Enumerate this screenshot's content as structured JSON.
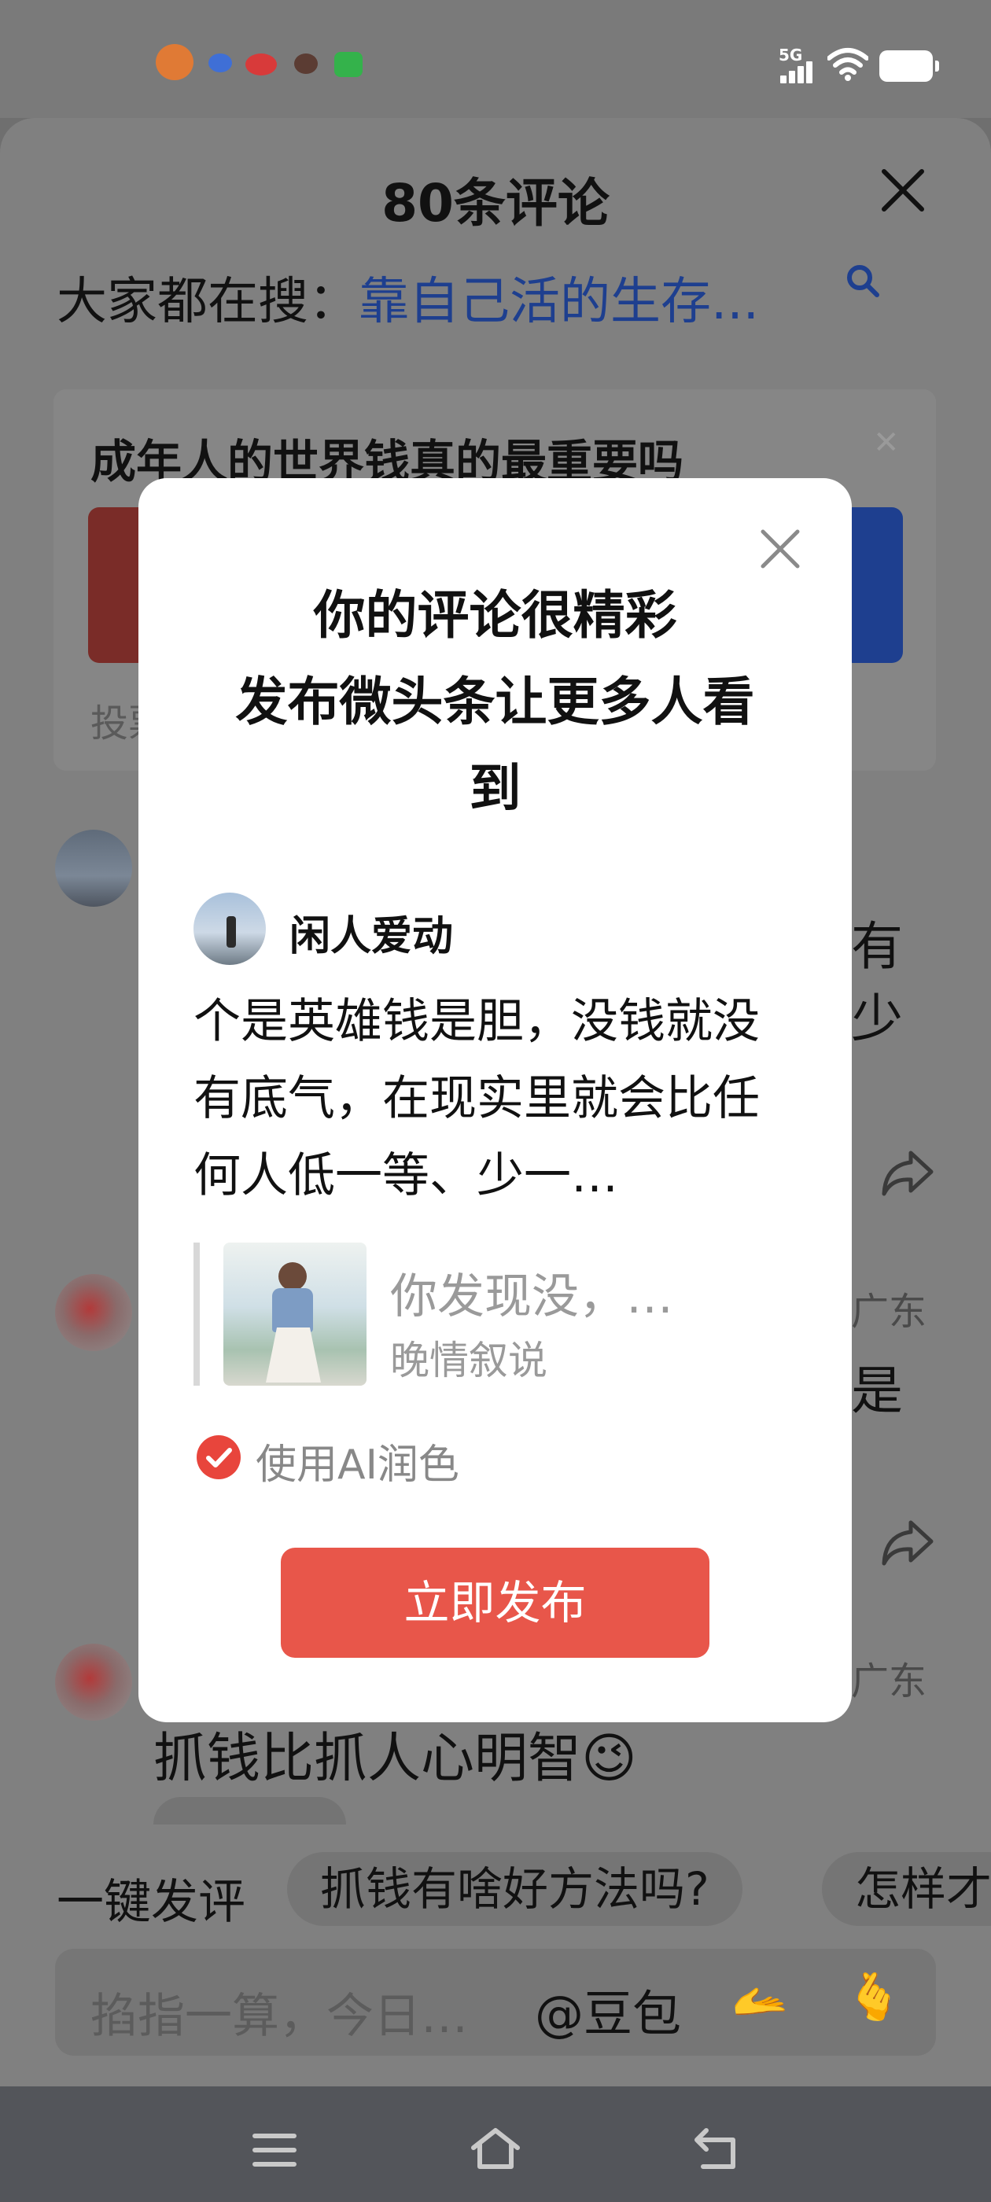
{
  "colors": {
    "accent": "#e8564a",
    "link": "#1e3f8f",
    "overlay": "#808080"
  },
  "status_bar": {
    "network": "5G"
  },
  "sheet": {
    "title": "80条评论",
    "search_prefix": "大家都在搜：",
    "search_query": "靠自己活的生存...",
    "poll": {
      "title": "成年人的世界钱真的最重要吗",
      "footer": "投票"
    },
    "bg_fragments": {
      "frag1": "有",
      "frag2": "少",
      "region1": "广东",
      "frag3": "是",
      "region2": "广东"
    },
    "comment_text": "抓钱比抓人心明智",
    "comment_emoji": "😉"
  },
  "bottom": {
    "quick_label": "一键发评",
    "chips": [
      "抓钱有啥好方法吗?",
      "怎样才"
    ],
    "input_placeholder": "掐指一算，今日…",
    "doubao": "@豆包",
    "emoji1": "🫴",
    "emoji2": "🫰"
  },
  "modal": {
    "title_line1": "你的评论很精彩",
    "title_line2": "发布微头条让更多人看",
    "title_line3": "到",
    "username": "闲人爱动",
    "text": "个是英雄钱是胆，没钱就没有底气，在现实里就会比任何人低一等、少一…",
    "quote_title": "你发现没，…",
    "quote_author": "晚情叙说",
    "ai_polish_label": "使用AI润色",
    "ai_polish_checked": true,
    "publish_label": "立即发布"
  }
}
